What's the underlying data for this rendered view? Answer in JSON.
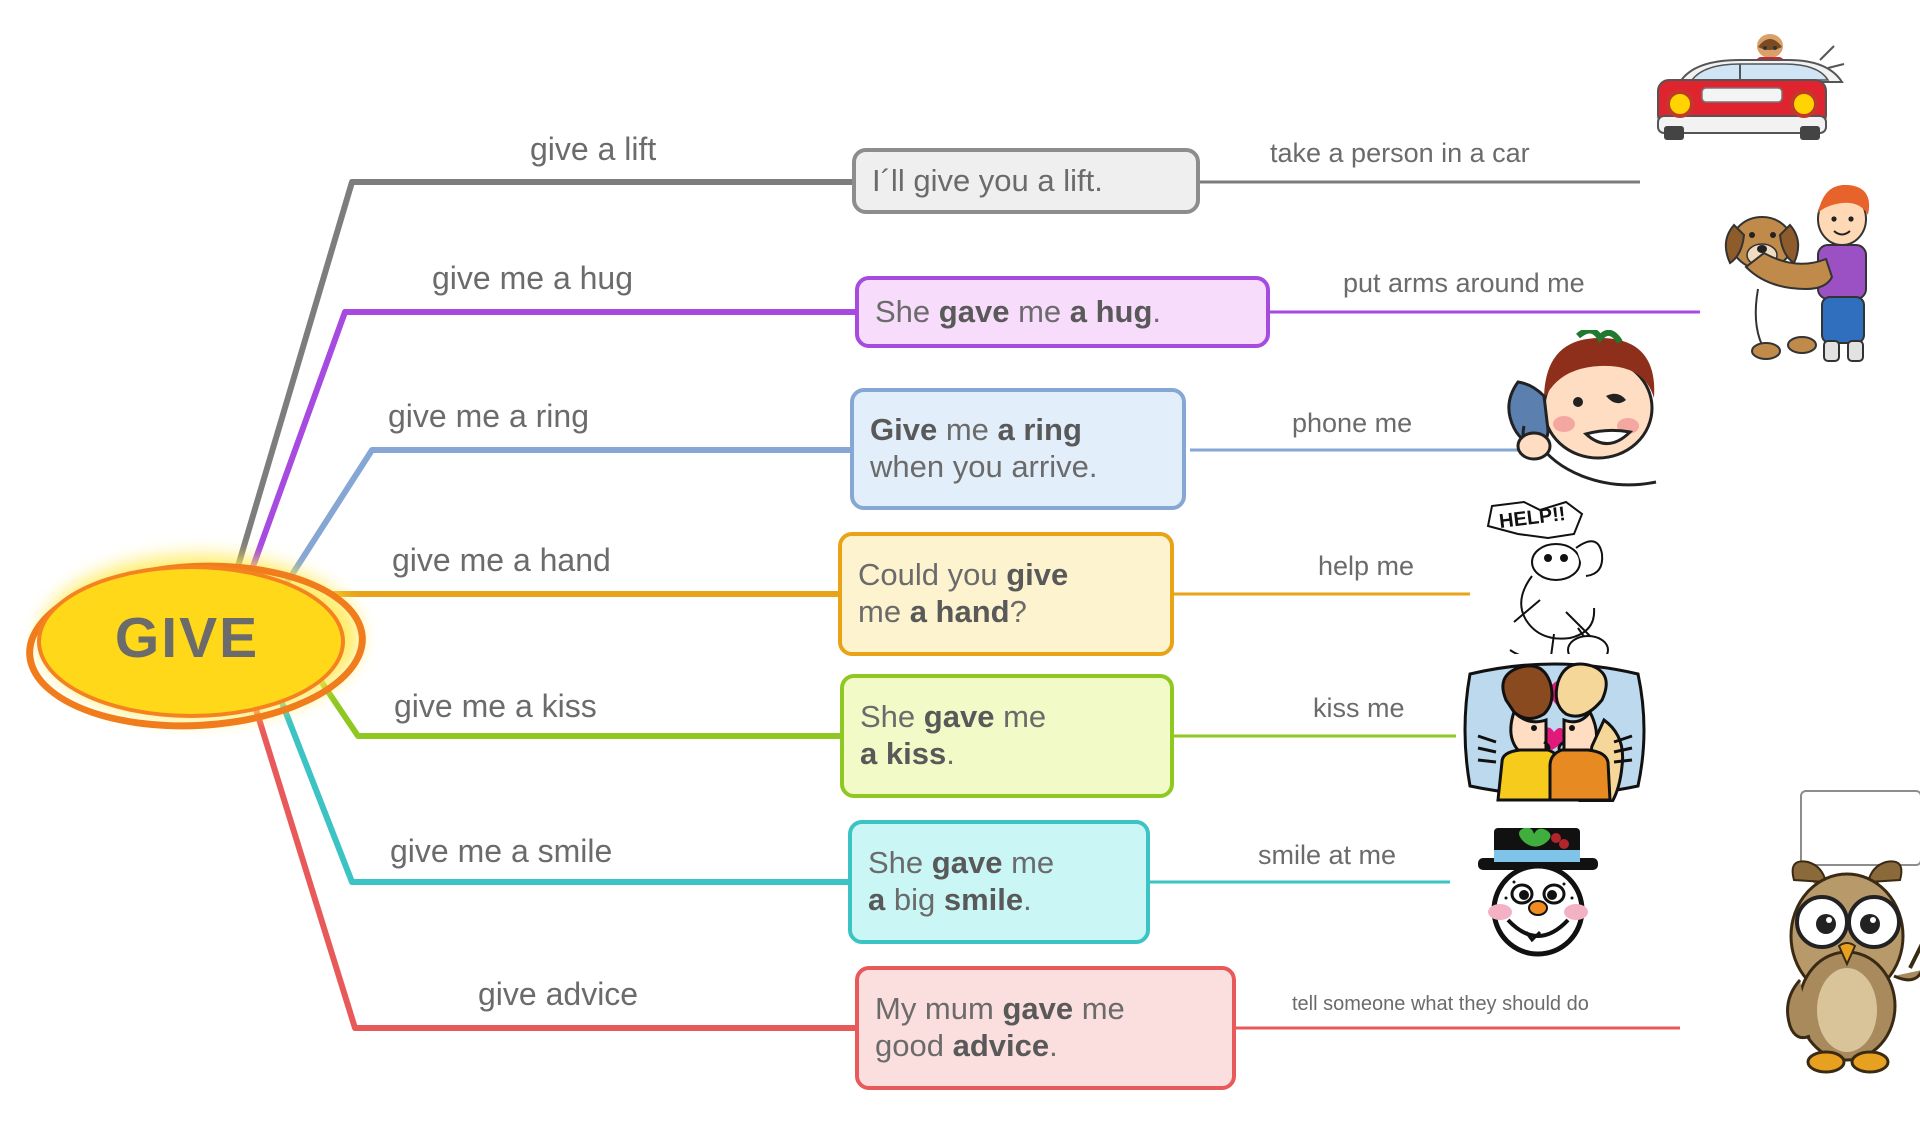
{
  "center": {
    "label": "GIVE",
    "color": "#ffd819",
    "ring_color": "#f07c1b"
  },
  "branches": [
    {
      "id": "lift",
      "phrase": "give a lift",
      "example_plain": "I´ll give you a lift.",
      "example_parts": [
        {
          "text": "I´ll give you a lift.",
          "bold": false
        }
      ],
      "meaning": "take a person in a car",
      "color": "#7d7d7d",
      "box_fill": "#efefef",
      "box_border": "#8d8d8d",
      "art": "car-with-driver"
    },
    {
      "id": "hug",
      "phrase": "give me a hug",
      "example_plain": "She gave me a hug.",
      "example_parts": [
        {
          "text": "She ",
          "bold": false
        },
        {
          "text": "gave",
          "bold": true
        },
        {
          "text": " me ",
          "bold": false
        },
        {
          "text": "a hug",
          "bold": true
        },
        {
          "text": ".",
          "bold": false
        }
      ],
      "meaning": "put arms around me",
      "color": "#a64ae0",
      "box_fill": "#f7dcfb",
      "box_border": "#a64ae0",
      "art": "girl-hugging-dog"
    },
    {
      "id": "ring",
      "phrase": "give me a ring",
      "example_plain": "Give me a ring when you arrive.",
      "example_parts": [
        {
          "text": "Give",
          "bold": true
        },
        {
          "text": " me ",
          "bold": false
        },
        {
          "text": "a ring",
          "bold": true
        },
        {
          "text": "\nwhen you arrive.",
          "bold": false
        }
      ],
      "meaning": "phone me",
      "color": "#86a6d4",
      "box_fill": "#e2eef9",
      "box_border": "#86a6d4",
      "art": "girl-on-phone"
    },
    {
      "id": "hand",
      "phrase": "give me a hand",
      "example_plain": "Could you give me a hand?",
      "example_parts": [
        {
          "text": "Could you ",
          "bold": false
        },
        {
          "text": "give",
          "bold": true
        },
        {
          "text": "\nme ",
          "bold": false
        },
        {
          "text": "a hand",
          "bold": true
        },
        {
          "text": "?",
          "bold": false
        }
      ],
      "meaning": "help me",
      "color": "#e8a317",
      "box_fill": "#fdf4cf",
      "box_border": "#e8a317",
      "art": "help-sketch"
    },
    {
      "id": "kiss",
      "phrase": "give me a kiss",
      "example_plain": "She gave me a kiss.",
      "example_parts": [
        {
          "text": "She ",
          "bold": false
        },
        {
          "text": "gave",
          "bold": true
        },
        {
          "text": " me\n",
          "bold": false
        },
        {
          "text": "a kiss",
          "bold": true
        },
        {
          "text": ".",
          "bold": false
        }
      ],
      "meaning": "kiss me",
      "color": "#8ec820",
      "box_fill": "#f2fac8",
      "box_border": "#8ec820",
      "art": "couple-kissing"
    },
    {
      "id": "smile",
      "phrase": "give me a smile",
      "example_plain": "She gave me a big smile.",
      "example_parts": [
        {
          "text": "She ",
          "bold": false
        },
        {
          "text": "gave",
          "bold": true
        },
        {
          "text": " me\n",
          "bold": false
        },
        {
          "text": "a",
          "bold": true
        },
        {
          "text": " big ",
          "bold": false
        },
        {
          "text": "smile",
          "bold": true
        },
        {
          "text": ".",
          "bold": false
        }
      ],
      "meaning": "smile at me",
      "color": "#3cc3c3",
      "box_fill": "#caf6f6",
      "box_border": "#3cc3c3",
      "art": "snowman-face"
    },
    {
      "id": "advice",
      "phrase": "give advice",
      "example_plain": "My mum gave me good advice.",
      "example_parts": [
        {
          "text": "My mum ",
          "bold": false
        },
        {
          "text": "gave",
          "bold": true
        },
        {
          "text": " me\n",
          "bold": false
        },
        {
          "text": "good ",
          "bold": false
        },
        {
          "text": "advice",
          "bold": true
        },
        {
          "text": ".",
          "bold": false
        }
      ],
      "meaning": "tell someone what they should do",
      "color": "#e85a5a",
      "box_fill": "#fbdede",
      "box_border": "#e85a5a",
      "art": "owl-teacher"
    }
  ]
}
